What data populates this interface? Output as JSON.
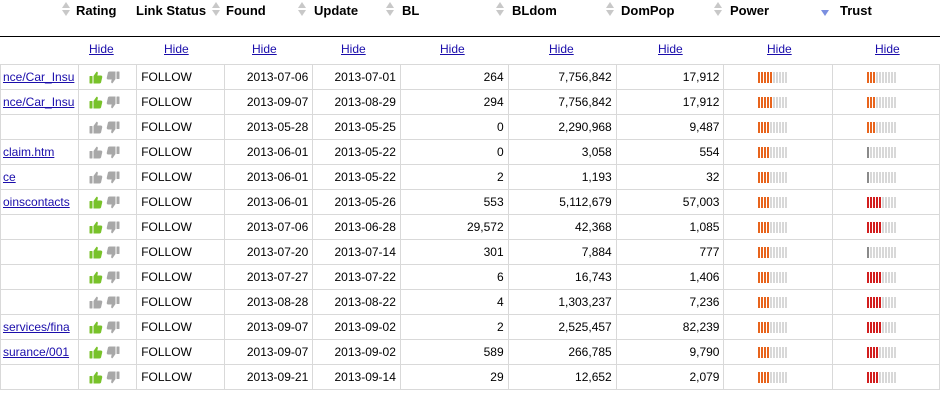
{
  "header": {
    "columns": [
      "Rating",
      "Link Status",
      "Found",
      "Update",
      "BL",
      "BLdom",
      "DomPop",
      "Power",
      "Trust"
    ],
    "hide_label": "Hide",
    "sorted_column": "Trust"
  },
  "colors": {
    "link": "#1a0dab",
    "bar_active": "#e8641c",
    "bar_strong": "#d21e1e",
    "bar_inactive": "#d8d8d8",
    "thumb_up": "#78c22a",
    "thumb_neutral": "#a8a8a8",
    "sort_active": "#7b8fe0"
  },
  "rows": [
    {
      "url": "nce/Car_Insu",
      "rating": "up",
      "status": "FOLLOW",
      "found": "2013-07-06",
      "update": "2013-07-01",
      "bl": "264",
      "bldom": "7,756,842",
      "dompop": "17,912",
      "power": 5,
      "trust": 3
    },
    {
      "url": "nce/Car_Insu",
      "rating": "up",
      "status": "FOLLOW",
      "found": "2013-09-07",
      "update": "2013-08-29",
      "bl": "294",
      "bldom": "7,756,842",
      "dompop": "17,912",
      "power": 5,
      "trust": 3
    },
    {
      "url": "",
      "rating": "neutral",
      "status": "FOLLOW",
      "found": "2013-05-28",
      "update": "2013-05-25",
      "bl": "0",
      "bldom": "2,290,968",
      "dompop": "9,487",
      "power": 4,
      "trust": 3
    },
    {
      "url": "claim.htm",
      "rating": "neutral",
      "status": "FOLLOW",
      "found": "2013-06-01",
      "update": "2013-05-22",
      "bl": "0",
      "bldom": "3,058",
      "dompop": "554",
      "power": 4,
      "trust": 1
    },
    {
      "url": "ce",
      "rating": "neutral",
      "status": "FOLLOW",
      "found": "2013-06-01",
      "update": "2013-05-22",
      "bl": "2",
      "bldom": "1,193",
      "dompop": "32",
      "power": 4,
      "trust": 1
    },
    {
      "url": "oinscontacts",
      "rating": "up",
      "status": "FOLLOW",
      "found": "2013-06-01",
      "update": "2013-05-26",
      "bl": "553",
      "bldom": "5,112,679",
      "dompop": "57,003",
      "power": 4,
      "trust": 5
    },
    {
      "url": "",
      "rating": "up",
      "status": "FOLLOW",
      "found": "2013-07-06",
      "update": "2013-06-28",
      "bl": "29,572",
      "bldom": "42,368",
      "dompop": "1,085",
      "power": 4,
      "trust": 5
    },
    {
      "url": "",
      "rating": "up",
      "status": "FOLLOW",
      "found": "2013-07-20",
      "update": "2013-07-14",
      "bl": "301",
      "bldom": "7,884",
      "dompop": "777",
      "power": 4,
      "trust": 1
    },
    {
      "url": "",
      "rating": "up",
      "status": "FOLLOW",
      "found": "2013-07-27",
      "update": "2013-07-22",
      "bl": "6",
      "bldom": "16,743",
      "dompop": "1,406",
      "power": 4,
      "trust": 5
    },
    {
      "url": "",
      "rating": "neutral",
      "status": "FOLLOW",
      "found": "2013-08-28",
      "update": "2013-08-22",
      "bl": "4",
      "bldom": "1,303,237",
      "dompop": "7,236",
      "power": 4,
      "trust": 5
    },
    {
      "url": "services/fina",
      "rating": "up",
      "status": "FOLLOW",
      "found": "2013-09-07",
      "update": "2013-09-02",
      "bl": "2",
      "bldom": "2,525,457",
      "dompop": "82,239",
      "power": 4,
      "trust": 5
    },
    {
      "url": "surance/001",
      "rating": "up",
      "status": "FOLLOW",
      "found": "2013-09-07",
      "update": "2013-09-02",
      "bl": "589",
      "bldom": "266,785",
      "dompop": "9,790",
      "power": 4,
      "trust": 4
    },
    {
      "url": "",
      "rating": "up",
      "status": "FOLLOW",
      "found": "2013-09-21",
      "update": "2013-09-14",
      "bl": "29",
      "bldom": "12,652",
      "dompop": "2,079",
      "power": 4,
      "trust": 4
    }
  ]
}
